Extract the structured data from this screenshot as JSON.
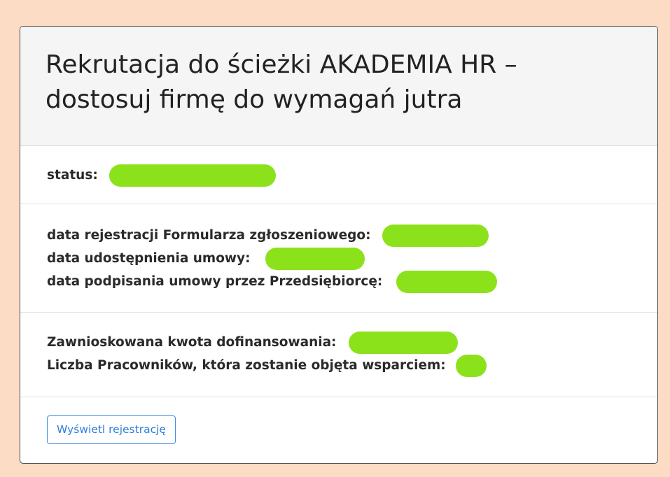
{
  "card": {
    "title": "Rekrutacja do ścieżki AKADEMIA HR – dostosuj firmę do wymagań jutra"
  },
  "status": {
    "label": "status:"
  },
  "dates": {
    "registration_label": "data rejestracji Formularza zgłoszeniowego:",
    "contract_shared_label": "data udostępnienia umowy:",
    "contract_signed_label": "data podpisania umowy przez Przedsiębiorcę:"
  },
  "funding": {
    "requested_amount_label": "Zawnioskowana kwota dofinansowania:",
    "employees_label": "Liczba Pracowników, która zostanie objęta wsparciem:"
  },
  "actions": {
    "view_registration_label": "Wyświetl rejestrację"
  },
  "colors": {
    "background": "#fcdcc4",
    "redaction": "#8ce21a",
    "link_blue": "#2f7ed8"
  }
}
